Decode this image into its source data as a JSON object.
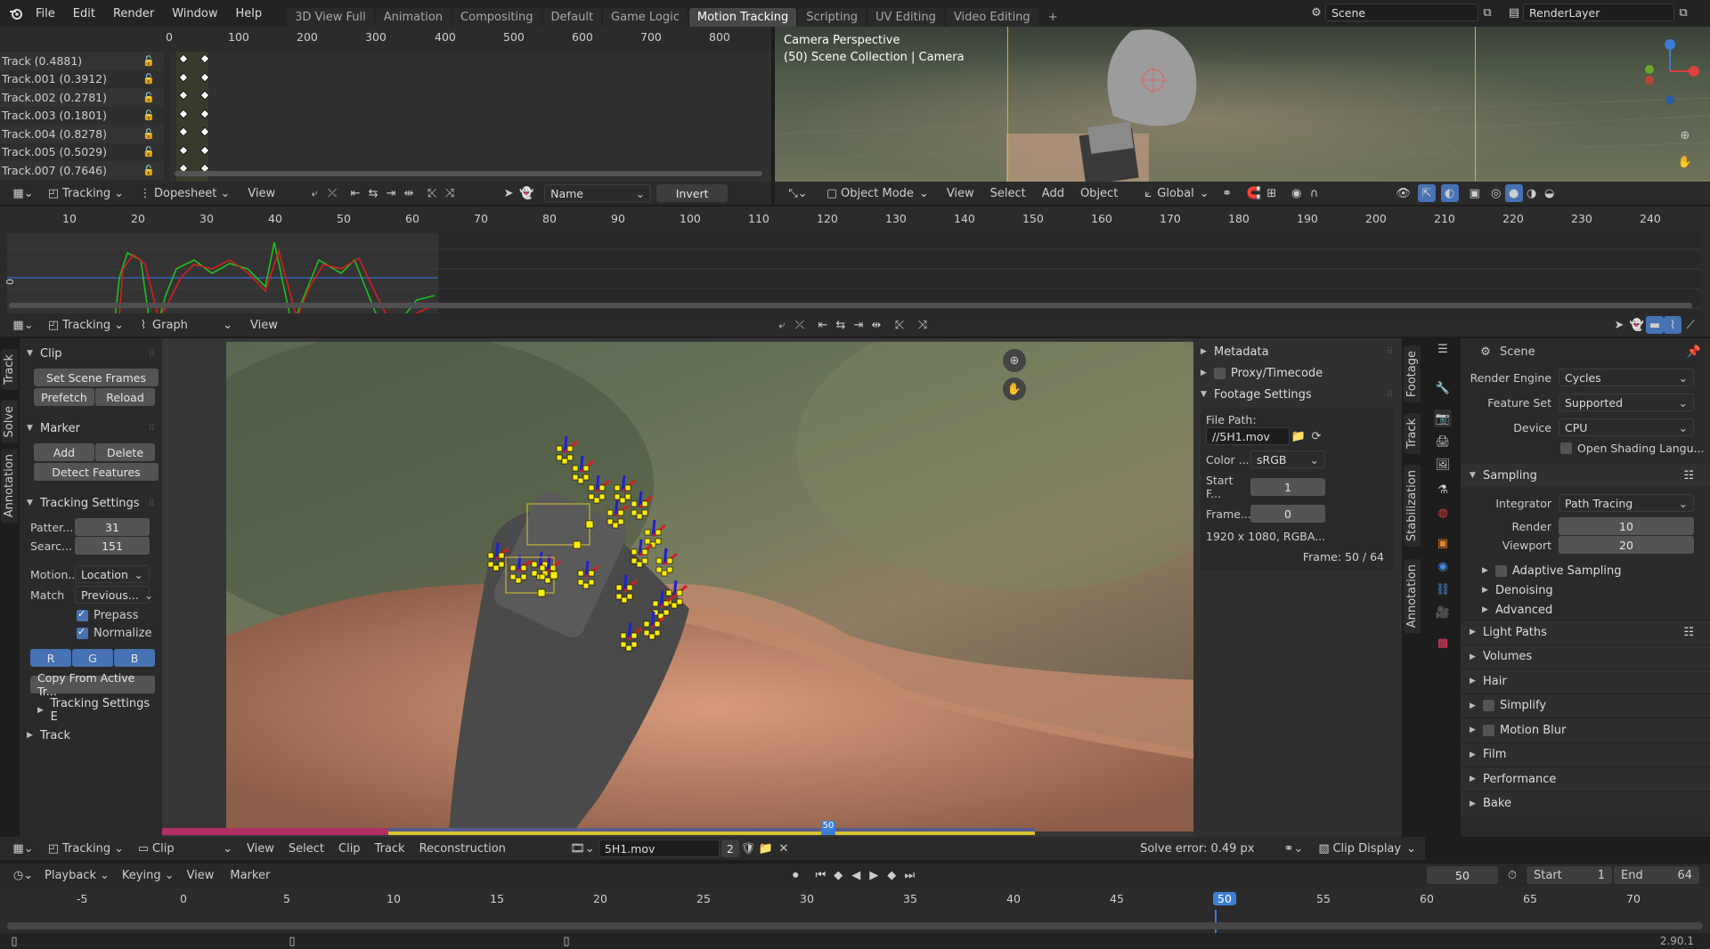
{
  "menu": {
    "file": "File",
    "edit": "Edit",
    "render": "Render",
    "window": "Window",
    "help": "Help"
  },
  "workspaces": [
    "3D View Full",
    "Animation",
    "Compositing",
    "Default",
    "Game Logic",
    "Motion Tracking",
    "Scripting",
    "UV Editing",
    "Video Editing"
  ],
  "active_workspace": "Motion Tracking",
  "scene": {
    "name": "Scene",
    "layer": "RenderLayer"
  },
  "dopesheet": {
    "ruler": [
      "0",
      "100",
      "200",
      "300",
      "400",
      "500",
      "600",
      "700",
      "800"
    ],
    "tracks": [
      "Track (0.4881)",
      "Track.001 (0.3912)",
      "Track.002 (0.2781)",
      "Track.003 (0.1801)",
      "Track.004 (0.8278)",
      "Track.005 (0.5029)",
      "Track.007 (0.7646)"
    ],
    "header": {
      "editor": "Tracking",
      "mode": "Dopesheet",
      "view": "View",
      "sort": "Name",
      "invert": "Invert"
    }
  },
  "viewport": {
    "title": "Camera Perspective",
    "subtitle": "(50) Scene Collection | Camera",
    "header": {
      "mode": "Object Mode",
      "view": "View",
      "select": "Select",
      "add": "Add",
      "object": "Object",
      "orientation": "Global"
    }
  },
  "graph": {
    "ruler": [
      "10",
      "20",
      "30",
      "40",
      "50",
      "60",
      "70",
      "80",
      "90",
      "100",
      "110",
      "120",
      "130",
      "140",
      "150",
      "160",
      "170",
      "180",
      "190",
      "200",
      "210",
      "220",
      "230",
      "240"
    ],
    "zero": "0",
    "header": {
      "editor": "Tracking",
      "mode": "Graph",
      "view": "View"
    }
  },
  "vtabs_left": [
    "Track",
    "Solve",
    "Annotation"
  ],
  "tool_panel": {
    "clip": {
      "title": "Clip",
      "set_scene_frames": "Set Scene Frames",
      "prefetch": "Prefetch",
      "reload": "Reload"
    },
    "marker": {
      "title": "Marker",
      "add": "Add",
      "delete": "Delete",
      "detect": "Detect Features"
    },
    "tracking_settings": {
      "title": "Tracking Settings",
      "pattern_label": "Patter...",
      "pattern": "31",
      "search_label": "Searc...",
      "search": "151",
      "motion_label": "Motion...",
      "motion": "Location",
      "match_label": "Match",
      "match": "Previous...",
      "prepass": "Prepass",
      "normalize": "Normalize",
      "r": "R",
      "g": "G",
      "b": "B",
      "copy": "Copy From Active Tr...",
      "extra": "Tracking Settings E"
    },
    "track": "Track"
  },
  "footage": {
    "metadata": "Metadata",
    "proxy": "Proxy/Timecode",
    "settings": "Footage Settings",
    "file_path_label": "File Path:",
    "file_path": "//5H1.mov",
    "color_label": "Color ...",
    "color": "sRGB",
    "start_label": "Start F...",
    "start": "1",
    "frame_label": "Frame...",
    "frame": "0",
    "info": "1920 x 1080, RGBA...",
    "frame_info": "Frame: 50 / 64"
  },
  "vtabs_right": [
    "Footage",
    "Track",
    "Stabilization",
    "Annotation"
  ],
  "clip_header": {
    "editor": "Tracking",
    "mode": "Clip",
    "view": "View",
    "select": "Select",
    "clip": "Clip",
    "track": "Track",
    "reconstruction": "Reconstruction",
    "file": "5H1.mov",
    "users": "2",
    "solve_error": "Solve error: 0.49 px",
    "display": "Clip Display"
  },
  "properties": {
    "scene": "Scene",
    "render_engine_label": "Render Engine",
    "render_engine": "Cycles",
    "feature_set_label": "Feature Set",
    "feature_set": "Supported",
    "device_label": "Device",
    "device": "CPU",
    "osl": "Open Shading Langu...",
    "sampling": "Sampling",
    "integrator_label": "Integrator",
    "integrator": "Path Tracing",
    "render_label": "Render",
    "render": "10",
    "viewport_label": "Viewport",
    "viewport": "20",
    "adaptive": "Adaptive Sampling",
    "denoising": "Denoising",
    "advanced": "Advanced",
    "sections": [
      "Light Paths",
      "Volumes",
      "Hair",
      "Simplify",
      "Motion Blur",
      "Film",
      "Performance",
      "Bake"
    ]
  },
  "timeline": {
    "playback": "Playback",
    "keying": "Keying",
    "view": "View",
    "marker": "Marker",
    "current": "50",
    "start_label": "Start",
    "start": "1",
    "end_label": "End",
    "end": "64",
    "ruler": [
      "-5",
      "0",
      "5",
      "10",
      "15",
      "20",
      "25",
      "30",
      "35",
      "40",
      "45",
      "50",
      "55",
      "60",
      "65",
      "70"
    ],
    "version": "2.90.1"
  },
  "colors": {
    "accent": "#4772b3",
    "active_frame": "#3d7fd6",
    "track_yellow": "#ffee00",
    "curve_red": "#d42020",
    "curve_green": "#20c020"
  }
}
